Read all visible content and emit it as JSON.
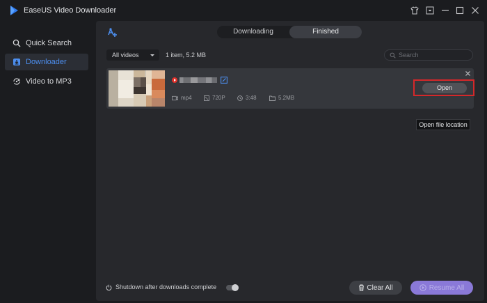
{
  "app": {
    "title": "EaseUS Video Downloader"
  },
  "sidebar": {
    "items": [
      {
        "label": "Quick Search",
        "icon": "search-icon",
        "active": false
      },
      {
        "label": "Downloader",
        "icon": "download-icon",
        "active": true
      },
      {
        "label": "Video to MP3",
        "icon": "convert-icon",
        "active": false
      }
    ]
  },
  "tabs": [
    {
      "label": "Downloading",
      "active": false
    },
    {
      "label": "Finished",
      "active": true
    }
  ],
  "filter": {
    "selected": "All videos"
  },
  "summary": "1 item, 5.2 MB",
  "search": {
    "placeholder": "Search"
  },
  "item": {
    "source_icon": "youtube-icon",
    "format": "mp4",
    "resolution": "720P",
    "duration": "3:48",
    "size": "5.2MB",
    "open_label": "Open",
    "tooltip": "Open file location"
  },
  "footer": {
    "shutdown_label": "Shutdown after downloads complete",
    "shutdown_enabled": false,
    "clear_label": "Clear All",
    "resume_label": "Resume All"
  },
  "colors": {
    "accent": "#4d8ff0",
    "resume": "#8a79d8",
    "highlight": "#d5282a"
  }
}
